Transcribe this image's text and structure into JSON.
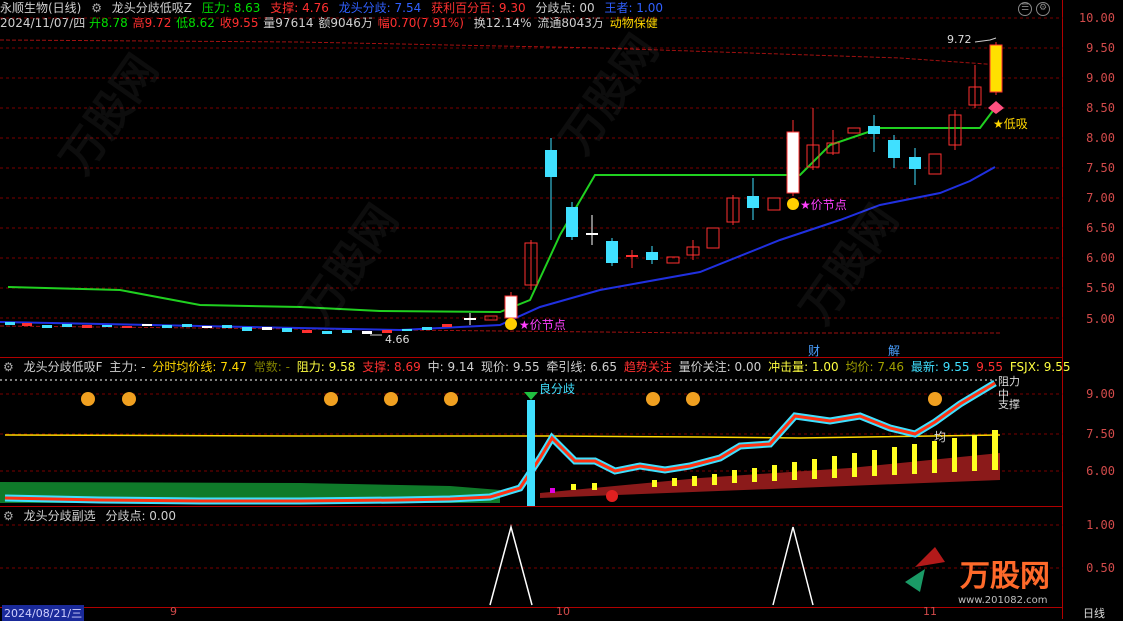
{
  "main_header": {
    "stock_name": "永顺生物(日线)",
    "indicator": "龙头分歧低吸Z",
    "pressure": "压力: 8.63",
    "support": "支撑: 4.76",
    "leader_div": "龙头分歧: 7.54",
    "profit_pct": "获利百分百: 9.30",
    "div_point": "分歧点: 00",
    "wang": "王者: 1.00"
  },
  "info_line": {
    "date": "2024/11/07/四",
    "open": "开8.78",
    "high": "高9.72",
    "low": "低8.62",
    "close": "收9.55",
    "volume": "量97614",
    "amount": "额9046万",
    "change": "幅0.70(7.91%)",
    "turnover": "换12.14%",
    "float": "流通8043万",
    "sector": "动物保健"
  },
  "main_axis": [
    "10.00",
    "9.50",
    "9.00",
    "8.50",
    "8.00",
    "7.50",
    "7.00",
    "6.50",
    "6.00",
    "5.50",
    "5.00"
  ],
  "annotations": {
    "high_label": "9.72",
    "low_label": "4.66",
    "price_node": "价节点",
    "low_buy": "低吸",
    "cai": "财",
    "jie": "解"
  },
  "sub1_header": {
    "indicator": "龙头分歧低吸F",
    "main_force": "主力: -",
    "avg_line": "分时均价线: 7.47",
    "chang_shu": "常数: -",
    "resistance": "阻力: 9.58",
    "support": "支撑: 8.69",
    "mid": "中: 9.14",
    "price_now": "现价: 9.55",
    "traction": "牵引线: 6.65",
    "trend": "趋势关注",
    "vol_focus": "量价关注: 0.00",
    "impact": "冲击量: 1.00",
    "avg_price": "均价: 7.46",
    "latest": "最新: 9.55",
    "latest2": "9.55",
    "fsjx": "FSJX: 9.55"
  },
  "sub1_axis": [
    "9.00",
    "7.50",
    "6.00"
  ],
  "sub1_labels": {
    "liang_fen_qi": "良分歧",
    "jun": "均",
    "zu_li": "阻力",
    "zhong": "中",
    "zhi_cheng": "支撑"
  },
  "sub2_header": {
    "indicator": "龙头分歧副选",
    "div_point": "分歧点: 0.00"
  },
  "sub2_axis": [
    "1.00",
    "0.50"
  ],
  "x_axis": {
    "start": "2024/08/21/三",
    "m9": "9",
    "m10": "10",
    "m11": "11",
    "period": "日线"
  },
  "watermark": "万股网",
  "watermark_url": "www.201082.com"
}
